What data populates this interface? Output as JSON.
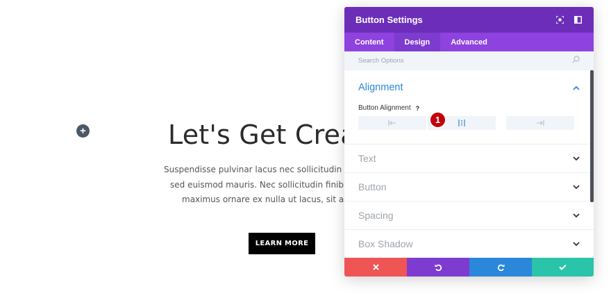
{
  "page": {
    "add_icon": "plus-icon",
    "hero_title": "Let's Get Crea",
    "hero_lines": [
      "Suspendisse pulvinar lacus nec sollicitudin finibu",
      "sed euismod mauris. Nec sollicitudin finibus, lig",
      "maximus ornare ex nulla ut lacus, sit amet c"
    ],
    "cta_label": "LEARN MORE"
  },
  "modal": {
    "title": "Button Settings",
    "header_icons": [
      "fullscreen-icon",
      "sidebar-icon"
    ],
    "tabs": [
      {
        "label": "Content",
        "active": false
      },
      {
        "label": "Design",
        "active": true
      },
      {
        "label": "Advanced",
        "active": false
      }
    ],
    "search_placeholder": "Search Options",
    "open_section": {
      "title": "Alignment",
      "field_label": "Button Alignment",
      "help": "?",
      "options": [
        "left",
        "center",
        "right"
      ],
      "selected": "center"
    },
    "sections": [
      "Text",
      "Button",
      "Spacing",
      "Box Shadow"
    ],
    "badge": "1",
    "footer": [
      "close-icon",
      "undo-icon",
      "redo-icon",
      "check-icon"
    ]
  },
  "colors": {
    "header": "#6c2eb9",
    "tabs": "#8e42df",
    "accent_blue": "#2b87da",
    "close_red": "#ef5555",
    "save_teal": "#29c4a9",
    "badge_red": "#c0000b"
  }
}
